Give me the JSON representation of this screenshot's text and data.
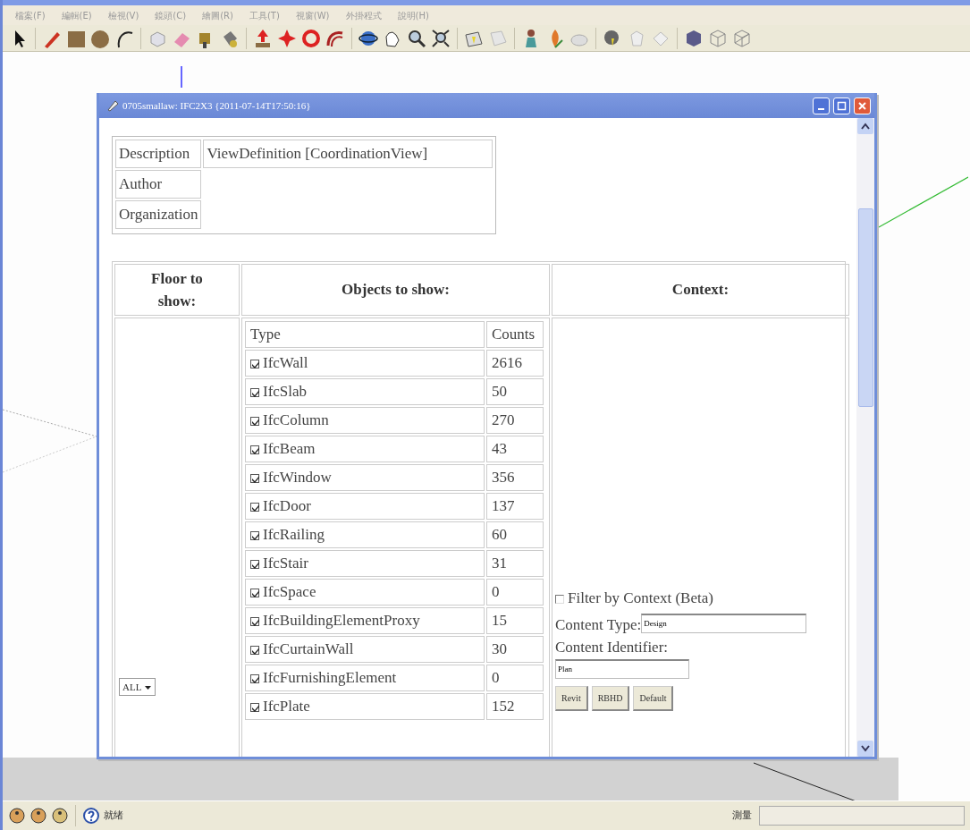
{
  "menu": [
    "檔案(F)",
    "編輯(E)",
    "檢視(V)",
    "鏡頭(C)",
    "繪圖(R)",
    "工具(T)",
    "視窗(W)",
    "外掛程式",
    "說明(H)"
  ],
  "dialog": {
    "title": "0705smallaw: IFC2X3 {2011-07-14T17:50:16}",
    "info": [
      {
        "label": "Description",
        "value": "ViewDefinition [CoordinationView]"
      },
      {
        "label": "Author"
      },
      {
        "label": "Organization"
      }
    ],
    "headers": [
      "Floor to show:",
      "Objects to show:",
      "Context:"
    ],
    "floor_select": "ALL",
    "objects": {
      "columns": [
        "Type",
        "Counts"
      ],
      "rows": [
        {
          "type": "IfcWall",
          "count": "2616",
          "checked": true
        },
        {
          "type": "IfcSlab",
          "count": "50",
          "checked": true
        },
        {
          "type": "IfcColumn",
          "count": "270",
          "checked": true
        },
        {
          "type": "IfcBeam",
          "count": "43",
          "checked": true
        },
        {
          "type": "IfcWindow",
          "count": "356",
          "checked": true
        },
        {
          "type": "IfcDoor",
          "count": "137",
          "checked": true
        },
        {
          "type": "IfcRailing",
          "count": "60",
          "checked": true
        },
        {
          "type": "IfcStair",
          "count": "31",
          "checked": true
        },
        {
          "type": "IfcSpace",
          "count": "0",
          "checked": true
        },
        {
          "type": "IfcBuildingElementProxy",
          "count": "15",
          "checked": true
        },
        {
          "type": "IfcCurtainWall",
          "count": "30",
          "checked": true
        },
        {
          "type": "IfcFurnishingElement",
          "count": "0",
          "checked": true
        },
        {
          "type": "IfcPlate",
          "count": "152",
          "checked": true
        }
      ]
    },
    "context": {
      "filter": {
        "label": "Filter by Context (Beta)",
        "checked": false
      },
      "fields": [
        {
          "label": "Content Type:",
          "value": "Design"
        },
        {
          "label": "Content Identifier:",
          "value": "Plan"
        }
      ],
      "buttons": [
        "Revit",
        "RBHD",
        "Default"
      ]
    }
  },
  "status_bar": {
    "text": "就绪",
    "measure_label": "測量"
  }
}
